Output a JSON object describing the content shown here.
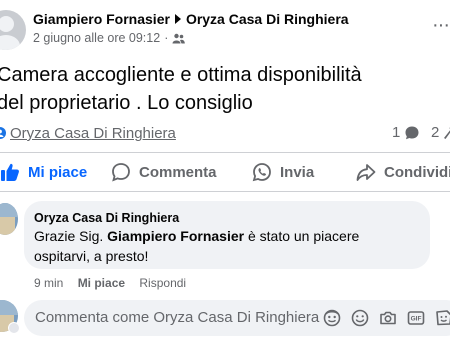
{
  "post": {
    "author": "Giampiero Fornasier",
    "target_page": "Oryza Casa Di Ringhiera",
    "timestamp": "2 giugno alle ore 09:12",
    "separator": "·",
    "more_label": "···",
    "text_line1": "Camera accogliente e ottima disponibilità",
    "text_line2": "del proprietario . Lo consiglio",
    "tagged_page": "Oryza Casa Di Ringhiera",
    "comment_count": "1",
    "share_count": "2"
  },
  "actions": {
    "like": "Mi piace",
    "comment": "Commenta",
    "send": "Invia",
    "share": "Condividi"
  },
  "comment": {
    "author": "Oryza Casa Di Ringhiera",
    "text_prefix": "Grazie Sig. ",
    "text_mention": "Giampiero Fornasier",
    "text_suffix": " è stato un piacere",
    "text_line2": "ospitarvi, a presto!",
    "time": "9 min",
    "like": "Mi piace",
    "reply": "Rispondi"
  },
  "composer": {
    "placeholder": "Commenta come Oryza Casa Di Ringhiera"
  },
  "colors": {
    "accent": "#0866ff",
    "secondary_text": "#65676b",
    "bubble_bg": "#f0f2f5"
  },
  "icons": [
    "audience-friends-icon",
    "more-icon",
    "page-icon",
    "comment-count-icon",
    "share-count-icon",
    "like-icon",
    "comment-icon",
    "whatsapp-icon",
    "share-icon",
    "avatar-sticker-icon",
    "emoji-icon",
    "camera-icon",
    "gif-icon",
    "sticker-icon"
  ]
}
